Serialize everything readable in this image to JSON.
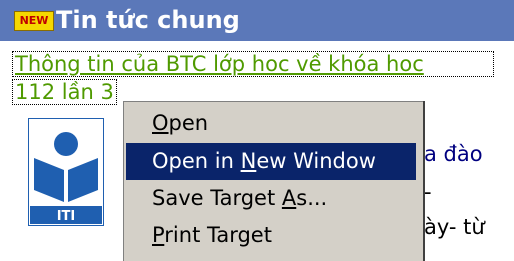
{
  "header": {
    "badge": "NEW",
    "title": "Tin tức chung"
  },
  "news": {
    "link_line1": "Thông tin của BTC lớp hoc về khóa hoc",
    "link_line2": "112 lần 3"
  },
  "logo": {
    "text": "ITI"
  },
  "side_text": {
    "line1": "a đào",
    "line2": "-",
    "line3": "ày- từ"
  },
  "context_menu": {
    "items": [
      {
        "pre": "",
        "key": "O",
        "post": "pen",
        "highlighted": false
      },
      {
        "pre": "Open in ",
        "key": "N",
        "post": "ew Window",
        "highlighted": true
      },
      {
        "pre": "Save Target ",
        "key": "A",
        "post": "s...",
        "highlighted": false
      },
      {
        "pre": "",
        "key": "P",
        "post": "rint Target",
        "highlighted": false
      }
    ]
  },
  "colors": {
    "header_bg": "#5b78b9",
    "link": "#4f9a00",
    "menu_bg": "#d4d0c8",
    "menu_highlight": "#0a246a"
  }
}
